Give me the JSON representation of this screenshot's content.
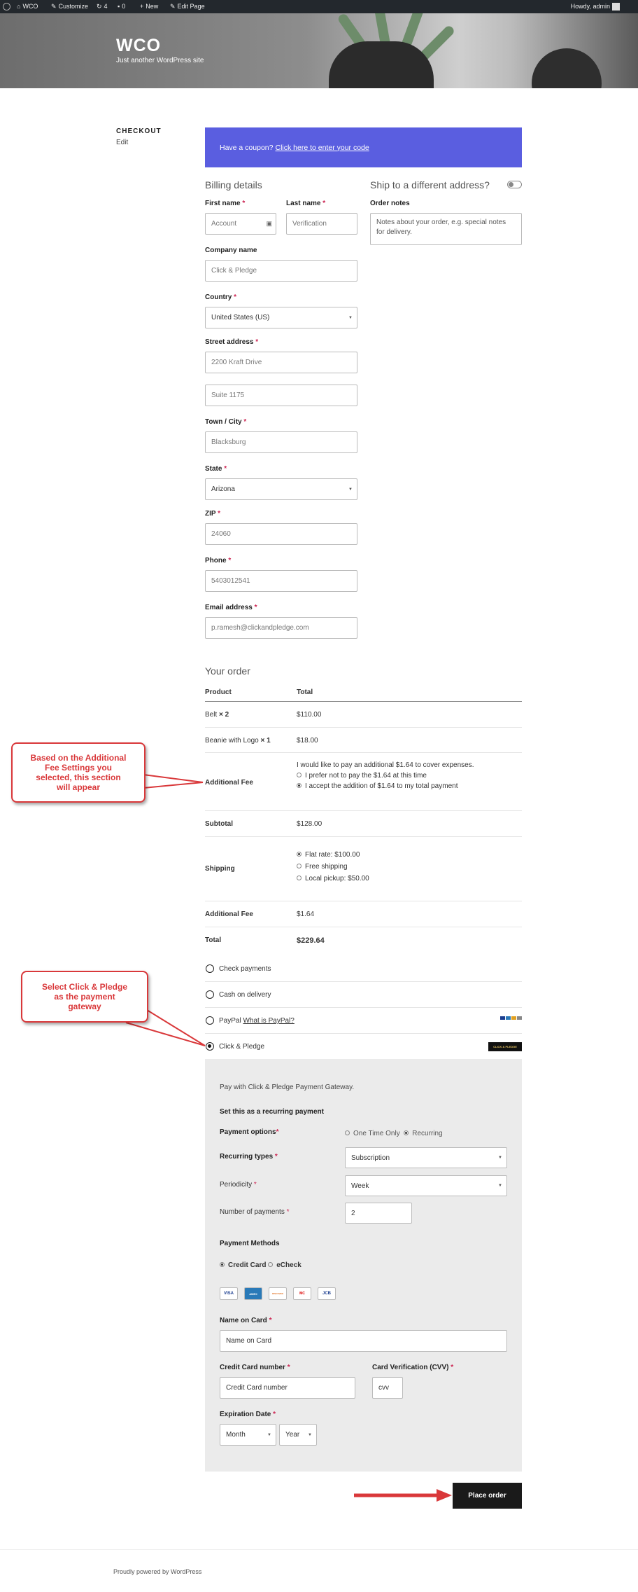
{
  "adminbar": {
    "site": "WCO",
    "customize": "Customize",
    "updates": "4",
    "comments": "0",
    "new": "New",
    "edit_page": "Edit Page",
    "howdy": "Howdy, admin"
  },
  "site": {
    "title": "WCO",
    "tagline": "Just another WordPress site"
  },
  "page": {
    "title": "CHECKOUT",
    "edit": "Edit"
  },
  "coupon": {
    "text": "Have a coupon?",
    "link": "Click here to enter your code",
    "bg": "#5a5ee0"
  },
  "billing": {
    "heading": "Billing details",
    "first_name": {
      "label": "First name",
      "placeholder": "Account"
    },
    "last_name": {
      "label": "Last name",
      "placeholder": "Verification"
    },
    "company": {
      "label": "Company name",
      "value": "Click & Pledge"
    },
    "country": {
      "label": "Country",
      "value": "United States (US)"
    },
    "street": {
      "label": "Street address",
      "line1": "2200 Kraft Drive",
      "line2": "Suite 1175"
    },
    "city": {
      "label": "Town / City",
      "value": "Blacksburg"
    },
    "state": {
      "label": "State",
      "value": "Arizona"
    },
    "zip": {
      "label": "ZIP",
      "value": "24060"
    },
    "phone": {
      "label": "Phone",
      "value": "5403012541"
    },
    "email": {
      "label": "Email address",
      "value": "p.ramesh@clickandpledge.com"
    }
  },
  "shipping": {
    "heading": "Ship to a different address?",
    "notes_label": "Order notes",
    "notes_placeholder": "Notes about your order, e.g. special notes for delivery."
  },
  "order": {
    "heading": "Your order",
    "col_product": "Product",
    "col_total": "Total",
    "items": [
      {
        "name": "Belt",
        "qty": "× 2",
        "total": "$110.00"
      },
      {
        "name": "Beanie with Logo",
        "qty": "× 1",
        "total": "$18.00"
      }
    ],
    "fee_label": "Additional Fee",
    "fee_intro": "I would like to pay an additional $1.64 to cover expenses.",
    "fee_opt1": "I prefer not to pay the $1.64 at this time",
    "fee_opt2": "I accept the addition of $1.64 to my total payment",
    "subtotal_label": "Subtotal",
    "subtotal": "$128.00",
    "shipping_label": "Shipping",
    "ship_opts": [
      "Flat rate: $100.00",
      "Free shipping",
      "Local pickup: $50.00"
    ],
    "fee2_label": "Additional Fee",
    "fee2": "$1.64",
    "total_label": "Total",
    "total": "$229.64"
  },
  "payment": {
    "methods": [
      "Check payments",
      "Cash on delivery",
      "PayPal",
      "Click & Pledge"
    ],
    "paypal_link": "What is PayPal?",
    "cnp_logo": "CLICK & PLEDGE",
    "box": {
      "desc": "Pay with Click & Pledge Payment Gateway.",
      "recurring_heading": "Set this as a recurring payment",
      "options_label": "Payment options",
      "opt_once": "One Time Only",
      "opt_recurring": "Recurring",
      "types_label": "Recurring types",
      "types_value": "Subscription",
      "periodicity_label": "Periodicity",
      "periodicity_value": "Week",
      "num_label": "Number of payments",
      "num_value": "2",
      "methods_heading": "Payment Methods",
      "m_cc": "Credit Card",
      "m_echeck": "eCheck",
      "cards": [
        "VISA",
        "AMEX",
        "DISCOVER",
        "MC",
        "JCB"
      ],
      "name_label": "Name on Card",
      "name_placeholder": "Name on Card",
      "cc_label": "Credit Card number",
      "cc_placeholder": "Credit Card number",
      "cvv_label": "Card Verification (CVV)",
      "cvv_placeholder": "cvv",
      "exp_label": "Expiration Date",
      "month": "Month",
      "year": "Year"
    }
  },
  "place_order": "Place order",
  "callouts": {
    "fee": "Based on the Additional Fee Settings you selected, this section will appear",
    "gateway": "Select Click & Pledge as the payment gateway"
  },
  "footer": "Proudly powered by WordPress",
  "colors": {
    "accent": "#cd2653",
    "callout": "#d9383a",
    "button": "#1a1a1a",
    "payment_box": "#ebebeb"
  }
}
